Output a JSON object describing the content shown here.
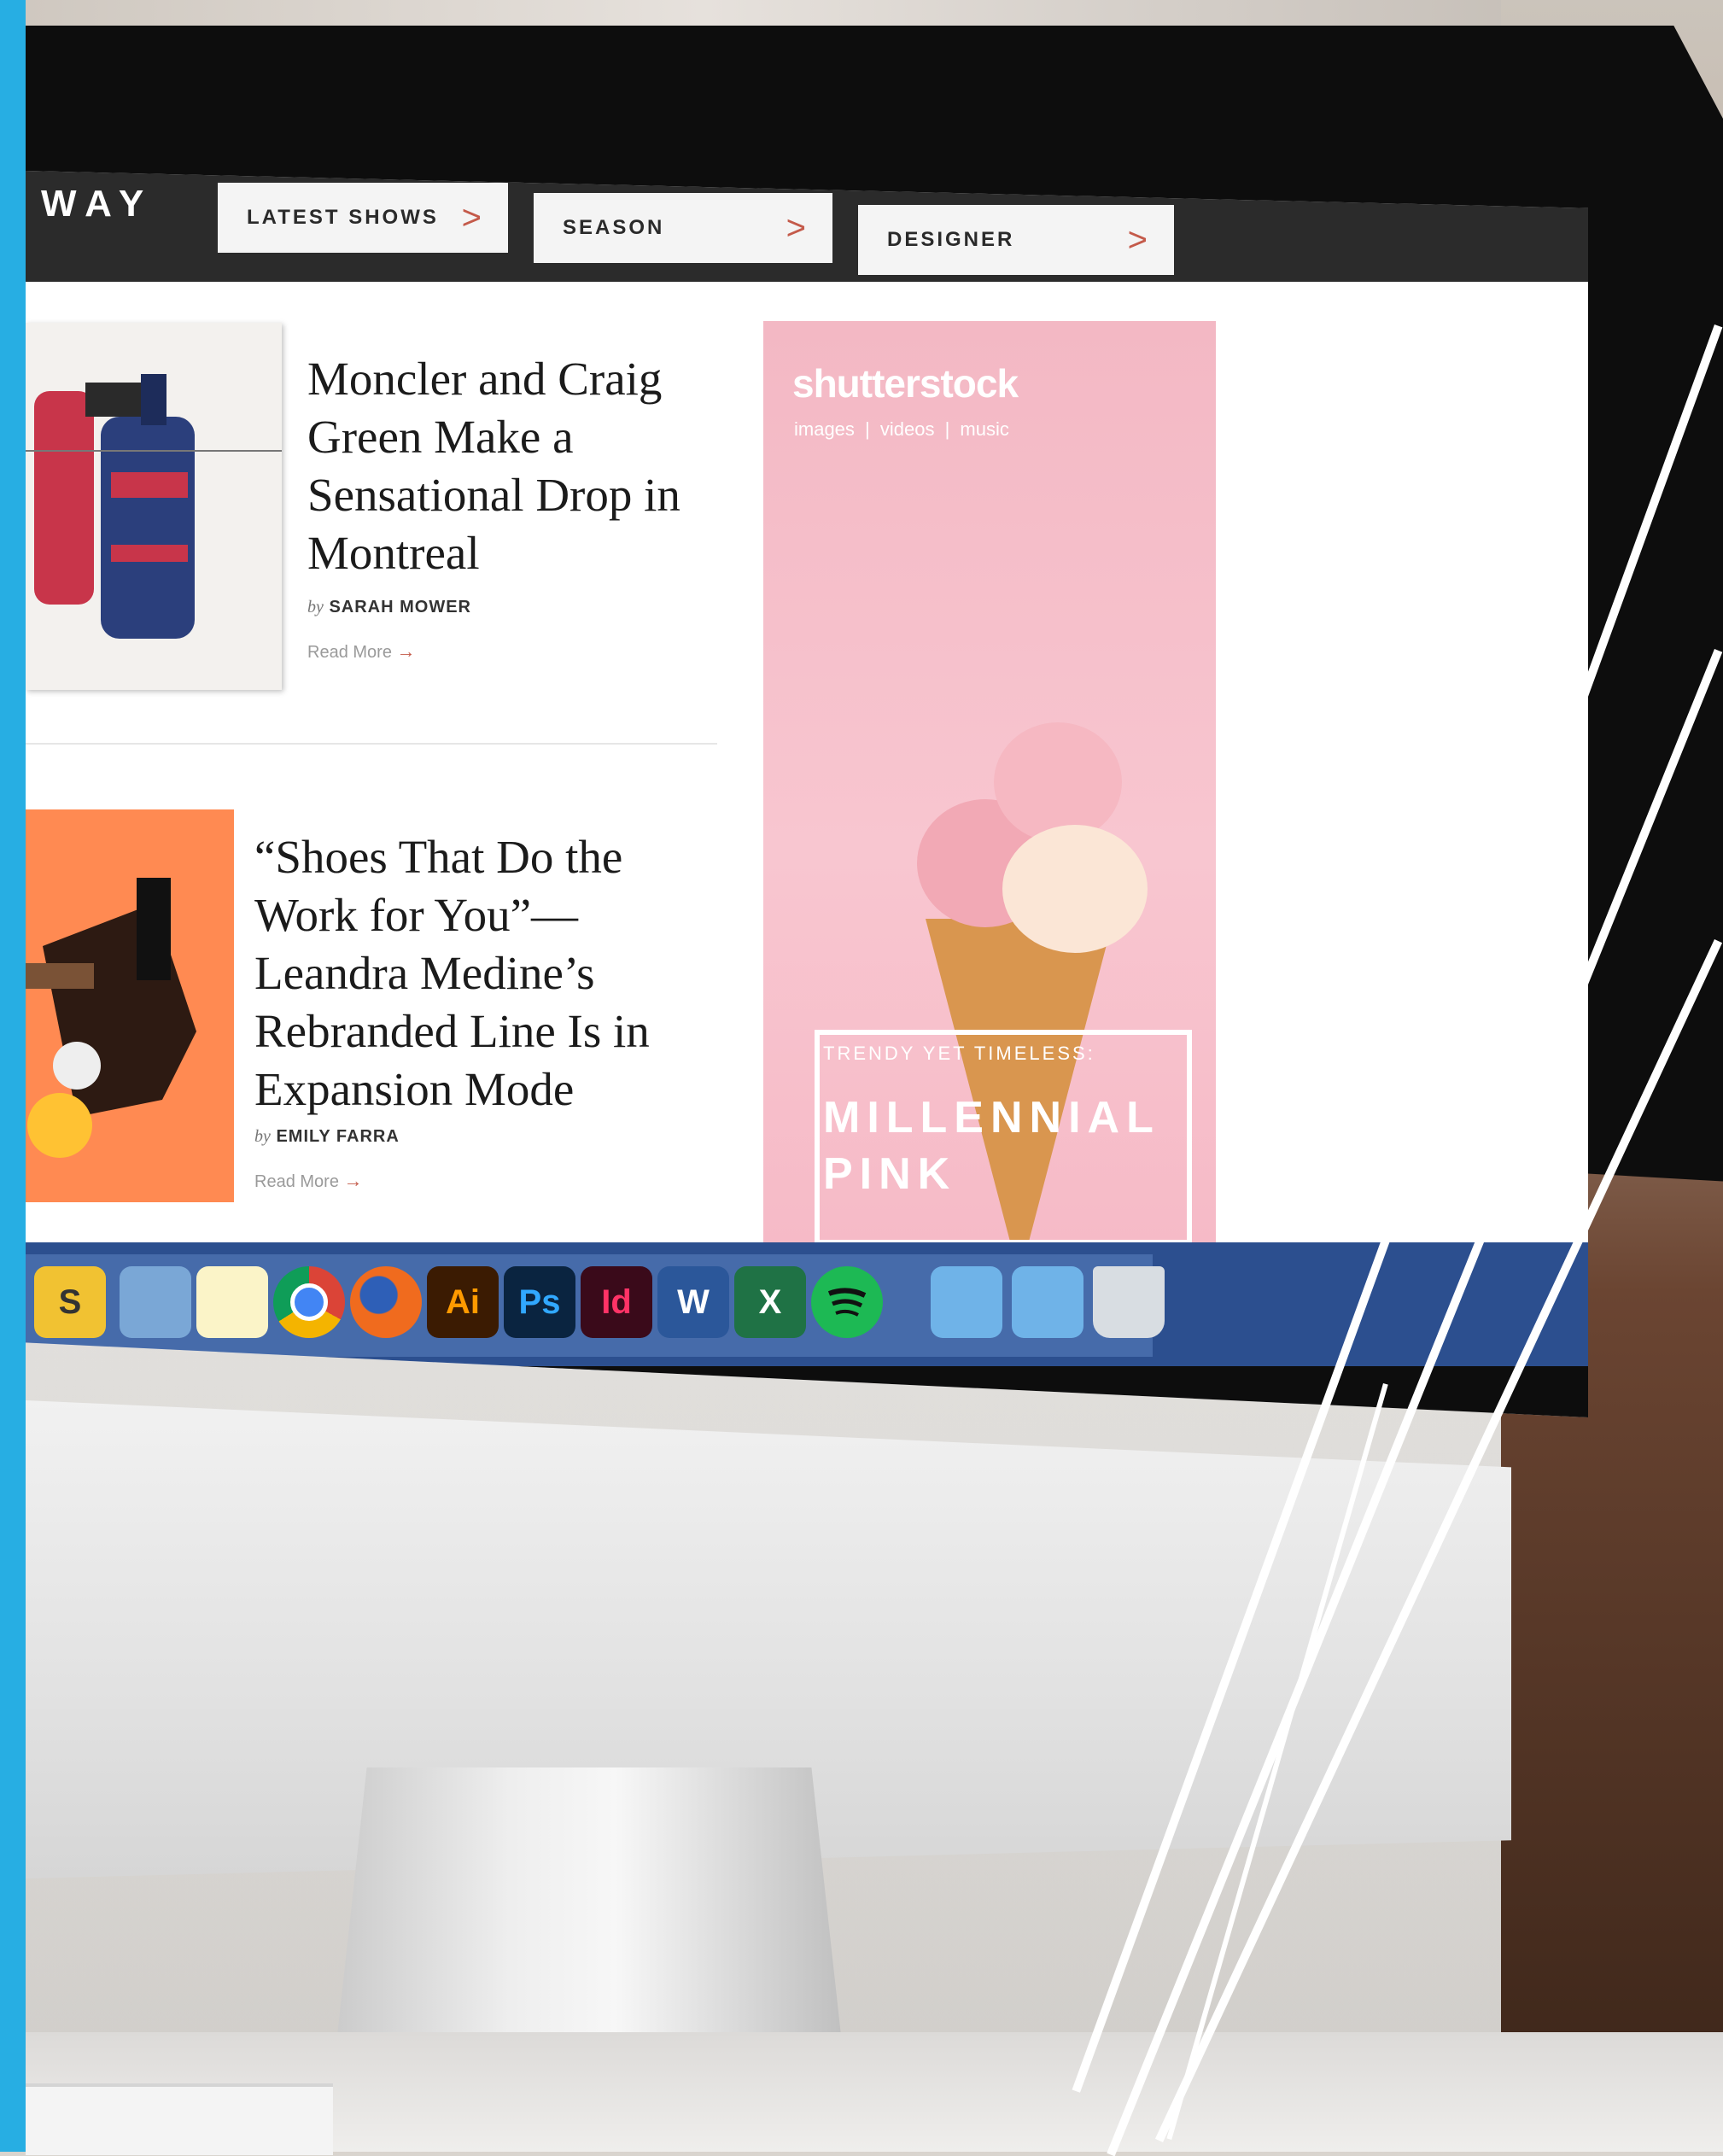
{
  "nav": {
    "logo": "WAY",
    "buttons": [
      {
        "label": "LATEST SHOWS",
        "chevron": ">"
      },
      {
        "label": "SEASON",
        "chevron": ">"
      },
      {
        "label": "DESIGNER",
        "chevron": ">"
      }
    ]
  },
  "articles": [
    {
      "headline": "Moncler and Craig Green Make a Sensational Drop in Montreal",
      "by": "by",
      "author": "SARAH MOWER",
      "read_more": "Read More",
      "arrow": "→"
    },
    {
      "headline": "“Shoes That Do the Work for You”— Leandra Medine’s Rebranded Line Is in Expansion Mode",
      "by": "by",
      "author": "EMILY FARRA",
      "read_more": "Read More",
      "arrow": "→"
    }
  ],
  "ad": {
    "brand": "shutterstock",
    "tagline": "images | videos | music",
    "kicker": "TRENDY YET TIMELESS:",
    "headline": "MILLENNIAL PINK"
  },
  "dock": {
    "items": [
      {
        "name": "slides-icon",
        "glyph": "S",
        "color": "#f1c232"
      },
      {
        "name": "mail-icon",
        "glyph": "",
        "color": "#7aa7d6"
      },
      {
        "name": "notes-icon",
        "glyph": "",
        "color": "#fbf4c8"
      },
      {
        "name": "chrome-icon",
        "glyph": "",
        "color": "#4aa04a"
      },
      {
        "name": "firefox-icon",
        "glyph": "",
        "color": "#f06b1e"
      },
      {
        "name": "illustrator-icon",
        "glyph": "Ai",
        "color": "#3b1b02"
      },
      {
        "name": "photoshop-icon",
        "glyph": "Ps",
        "color": "#0a2440"
      },
      {
        "name": "indesign-icon",
        "glyph": "Id",
        "color": "#3a0a1a"
      },
      {
        "name": "word-icon",
        "glyph": "W",
        "color": "#2b579a"
      },
      {
        "name": "excel-icon",
        "glyph": "X",
        "color": "#1f7245"
      },
      {
        "name": "spotify-icon",
        "glyph": "",
        "color": "#1db954"
      },
      {
        "name": "downloads-folder-icon",
        "glyph": "",
        "color": "#6fb3e8"
      },
      {
        "name": "dropbox-folder-icon",
        "glyph": "",
        "color": "#6fb3e8"
      },
      {
        "name": "trash-icon",
        "glyph": "",
        "color": "#d8dde2"
      }
    ]
  },
  "colors": {
    "accent": "#c45a4a",
    "nav_bg": "#2b2b2b",
    "frame_accent": "#27aee3"
  }
}
